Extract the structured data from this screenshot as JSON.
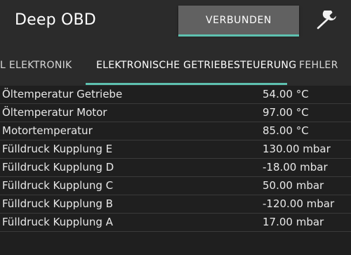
{
  "app": {
    "title": "Deep OBD"
  },
  "toolbar": {
    "connect_label": "VERBUNDEN",
    "settings_icon": "wrench-icon"
  },
  "tabs": [
    {
      "label": "L ELEKTRONIK",
      "active": false
    },
    {
      "label": "ELEKTRONISCHE GETRIEBESTEUERUNG",
      "active": true
    },
    {
      "label": "FEHLER",
      "active": false
    }
  ],
  "readings": [
    {
      "name": "Öltemperatur Getriebe",
      "value": "54.00 °C"
    },
    {
      "name": "Öltemperatur Motor",
      "value": "97.00 °C"
    },
    {
      "name": "Motortemperatur",
      "value": "85.00 °C"
    },
    {
      "name": "Fülldruck Kupplung E",
      "value": "130.00 mbar"
    },
    {
      "name": "Fülldruck Kupplung D",
      "value": "-18.00 mbar"
    },
    {
      "name": "Fülldruck Kupplung C",
      "value": "50.00 mbar"
    },
    {
      "name": "Fülldruck Kupplung B",
      "value": "-120.00 mbar"
    },
    {
      "name": "Fülldruck Kupplung A",
      "value": "17.00 mbar"
    }
  ],
  "colors": {
    "accent": "#5ec1b0",
    "bar": "#2b2b2b",
    "background": "#1f1f1f",
    "button": "#616161"
  }
}
